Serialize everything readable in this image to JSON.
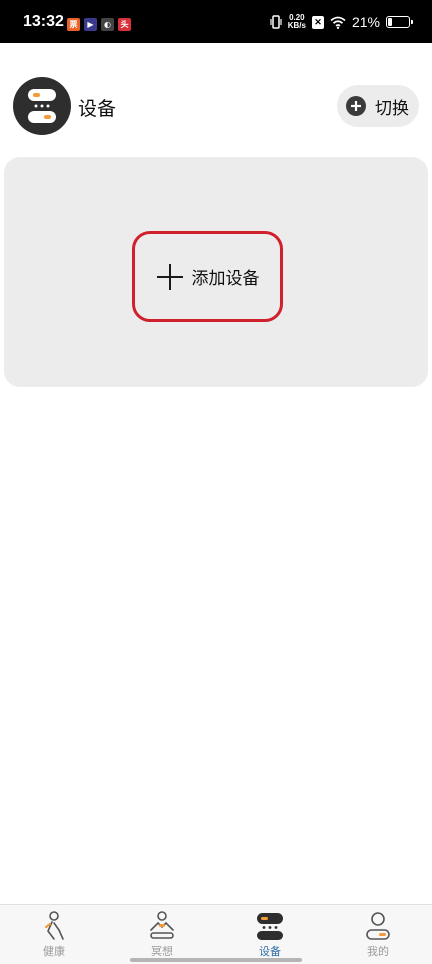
{
  "status_bar": {
    "time": "13:32",
    "app_icons": [
      {
        "name": "ticket-app-icon",
        "glyph": "票",
        "color": "#e8622a"
      },
      {
        "name": "video-app-icon",
        "glyph": "▶",
        "color": "#3a3a8c"
      },
      {
        "name": "swirl-app-icon",
        "glyph": "◐",
        "color": "#444444"
      },
      {
        "name": "news-app-icon",
        "glyph": "头",
        "color": "#d8313a"
      }
    ],
    "net_speed_value": "0.20",
    "net_speed_unit": "KB/s",
    "battery_percent": "21%",
    "battery_level": 0.21
  },
  "header": {
    "title": "设备",
    "switch_label": "切换"
  },
  "device_card": {
    "add_device_label": "添加设备",
    "highlight_color": "#d0202c"
  },
  "bottom_nav": {
    "tabs": [
      {
        "label": "健康",
        "icon": "health-person-icon",
        "active": false
      },
      {
        "label": "冥想",
        "icon": "meditation-icon",
        "active": false
      },
      {
        "label": "设备",
        "icon": "device-icon",
        "active": true
      },
      {
        "label": "我的",
        "icon": "profile-icon",
        "active": false
      }
    ],
    "active_color": "#2f6ea6",
    "accent_color": "#f29b38"
  }
}
